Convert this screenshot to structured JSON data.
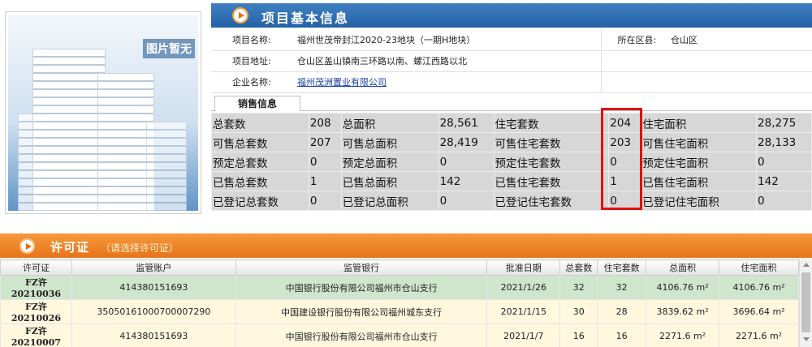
{
  "photo": {
    "no_image_text": "图片暂无"
  },
  "header": {
    "title": "项目基本信息"
  },
  "info": {
    "project_name_label": "项目名称:",
    "project_name": "福州世茂帝封江2020-23地块（一期H地块）",
    "district_label": "所在区县:",
    "district": "仓山区",
    "address_label": "项目地址:",
    "address": "仓山区盖山镇南三环路以南、螺江西路以北",
    "company_label": "企业名称:",
    "company": "福州茂洲置业有限公司"
  },
  "sales_tab": {
    "label": "销售信息"
  },
  "sales": {
    "rows": [
      [
        "总套数",
        "208",
        "总面积",
        "28,561",
        "住宅套数",
        "204",
        "住宅面积",
        "28,275"
      ],
      [
        "可售总套数",
        "207",
        "可售总面积",
        "28,419",
        "可售住宅套数",
        "203",
        "可售住宅面积",
        "28,133"
      ],
      [
        "预定总套数",
        "0",
        "预定总面积",
        "0",
        "预定住宅套数",
        "0",
        "预定住宅面积",
        "0"
      ],
      [
        "已售总套数",
        "1",
        "已售总面积",
        "142",
        "已售住宅套数",
        "1",
        "已售住宅面积",
        "142"
      ],
      [
        "已登记总套数",
        "0",
        "已登记总面积",
        "0",
        "已登记住宅套数",
        "0",
        "已登记住宅面积",
        "0"
      ]
    ],
    "highlight_color": "#e01010"
  },
  "permit_section": {
    "title": "许可证",
    "subtitle": "（请选择许可证）"
  },
  "permits": {
    "headers": [
      "许可证",
      "监管账户",
      "监管银行",
      "批准日期",
      "总套数",
      "住宅套数",
      "总面积",
      "住宅面积"
    ],
    "rows": [
      {
        "no": "FZ许20210036",
        "account": "414380151693",
        "bank": "中国银行股份有限公司福州市仓山支行",
        "date": "2021/1/26",
        "total": "32",
        "res": "32",
        "area": "4106.76 m²",
        "res_area": "4106.76 m²"
      },
      {
        "no": "FZ许20210026",
        "account": "35050161000700007290",
        "bank": "中国建设银行股份有限公司福州城东支行",
        "date": "2021/1/15",
        "total": "30",
        "res": "28",
        "area": "3839.62 m²",
        "res_area": "3696.64 m²"
      },
      {
        "no": "FZ许20210007",
        "account": "414380151693",
        "bank": "中国银行股份有限公司福州市仓山支行",
        "date": "2021/1/7",
        "total": "16",
        "res": "16",
        "area": "2271.6 m²",
        "res_area": "2271.6 m²"
      }
    ]
  },
  "colors": {
    "header_blue": "#2f6fb5",
    "permit_orange": "#ee7d22",
    "selected_row": "#cfe6cc",
    "row_bg": "#fff8df"
  }
}
